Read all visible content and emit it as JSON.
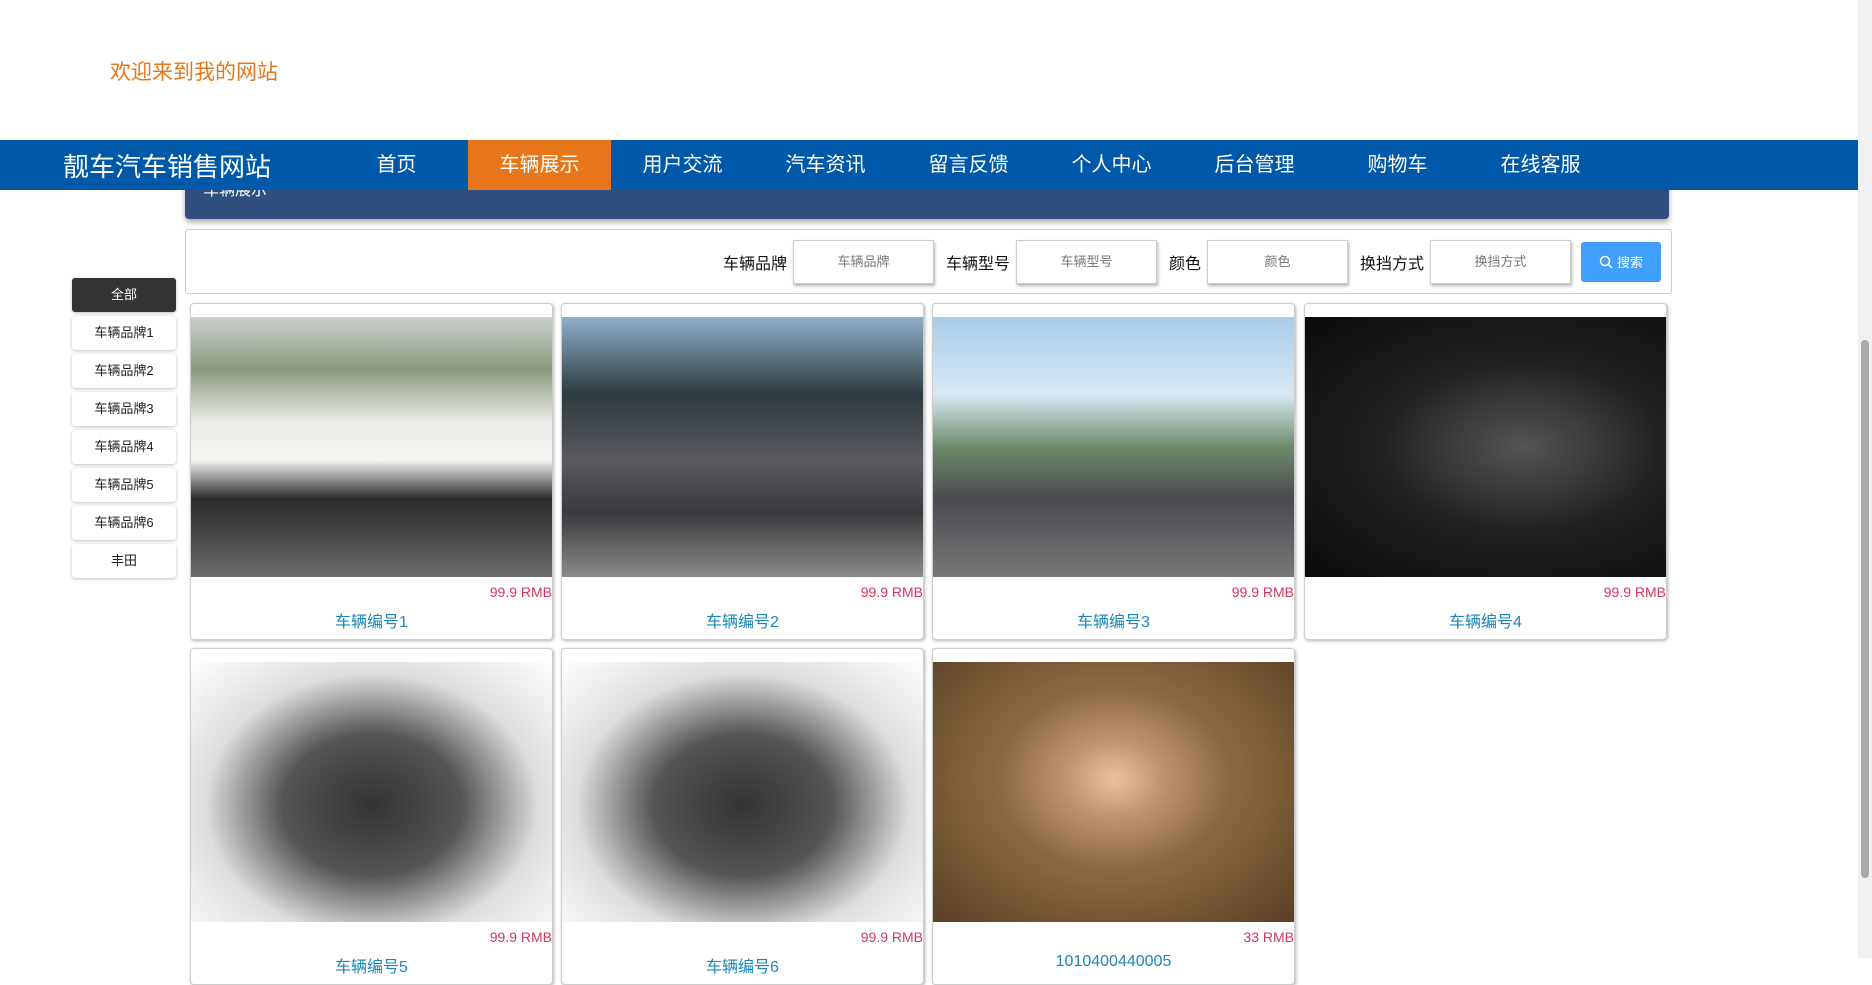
{
  "welcome": "欢迎来到我的网站",
  "nav": {
    "brand": "靓车汽车销售网站",
    "items": [
      "首页",
      "车辆展示",
      "用户交流",
      "汽车资讯",
      "留言反馈",
      "个人中心",
      "后台管理",
      "购物车",
      "在线客服"
    ],
    "active": 1
  },
  "banner_title": "车辆展示",
  "search": {
    "brand_label": "车辆品牌",
    "brand_placeholder": "车辆品牌",
    "model_label": "车辆型号",
    "model_placeholder": "车辆型号",
    "color_label": "颜色",
    "color_placeholder": "颜色",
    "gear_label": "换挡方式",
    "gear_placeholder": "换挡方式",
    "button": "搜索"
  },
  "sidebar": [
    "全部",
    "车辆品牌1",
    "车辆品牌2",
    "车辆品牌3",
    "车辆品牌4",
    "车辆品牌5",
    "车辆品牌6",
    "丰田"
  ],
  "cards": [
    {
      "title": "车辆编号1",
      "price": "99.9 RMB"
    },
    {
      "title": "车辆编号2",
      "price": "99.9 RMB"
    },
    {
      "title": "车辆编号3",
      "price": "99.9 RMB"
    },
    {
      "title": "车辆编号4",
      "price": "99.9 RMB"
    },
    {
      "title": "车辆编号5",
      "price": "99.9 RMB"
    },
    {
      "title": "车辆编号6",
      "price": "99.9 RMB"
    },
    {
      "title": "1010400440005",
      "price": "33 RMB"
    }
  ],
  "colors": {
    "nav": "#0058a8",
    "accent": "#e8761a",
    "banner": "#2f4f7e",
    "price": "#d4365a",
    "title": "#1b87b8"
  }
}
